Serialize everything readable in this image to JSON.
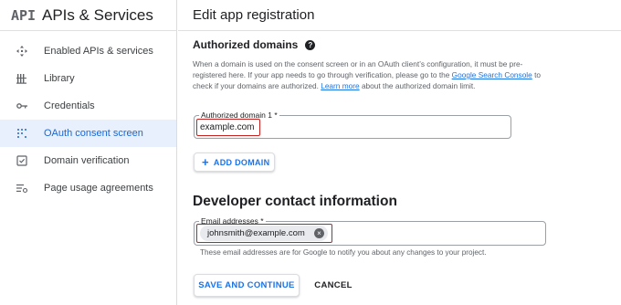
{
  "sidebar": {
    "logo": "API",
    "title": "APIs & Services",
    "items": [
      {
        "label": "Enabled APIs & services",
        "icon": "diamond-arrows-icon",
        "active": false
      },
      {
        "label": "Library",
        "icon": "library-icon",
        "active": false
      },
      {
        "label": "Credentials",
        "icon": "key-icon",
        "active": false
      },
      {
        "label": "OAuth consent screen",
        "icon": "dotted-grid-icon",
        "active": true
      },
      {
        "label": "Domain verification",
        "icon": "checkbox-icon",
        "active": false
      },
      {
        "label": "Page usage agreements",
        "icon": "settings-list-icon",
        "active": false
      }
    ]
  },
  "main": {
    "title": "Edit app registration",
    "authorized_domains": {
      "title": "Authorized domains",
      "desc_part1": "When a domain is used on the consent screen or in an OAuth client’s configuration, it must be pre-registered here. If your app needs to go through verification, please go to the ",
      "desc_link1": "Google Search Console",
      "desc_part2": " to check if your domains are authorized. ",
      "desc_link2": "Learn more",
      "desc_part3": " about the authorized domain limit.",
      "field_label": "Authorized domain 1 *",
      "field_value": "example.com",
      "add_button": "ADD DOMAIN"
    },
    "developer_contact": {
      "title": "Developer contact information",
      "field_label": "Email addresses *",
      "chip_value": "johnsmith@example.com",
      "hint": "These email addresses are for Google to notify you about any changes to your project."
    },
    "actions": {
      "save": "SAVE AND CONTINUE",
      "cancel": "CANCEL"
    }
  },
  "colors": {
    "accent": "#1a73e8",
    "active_bg": "#e8f0fe",
    "highlight": "#c5221f"
  }
}
